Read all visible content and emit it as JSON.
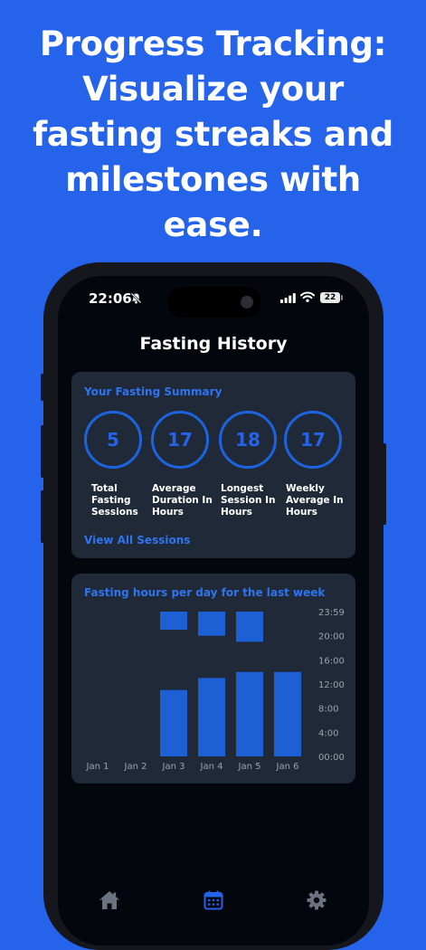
{
  "headline": {
    "lines": [
      "Progress Tracking:",
      "Visualize your",
      "fasting streaks and",
      "milestones with",
      "ease."
    ]
  },
  "status_bar": {
    "time": "22:06",
    "battery": "22"
  },
  "page": {
    "title": "Fasting History"
  },
  "summary": {
    "title": "Your Fasting Summary",
    "stats": [
      {
        "value": "5",
        "label_lines": [
          "Total",
          "Fasting",
          "Sessions"
        ]
      },
      {
        "value": "17",
        "label_lines": [
          "Average",
          "Duration In",
          "Hours"
        ]
      },
      {
        "value": "18",
        "label_lines": [
          "Longest",
          "Session In",
          "Hours"
        ]
      },
      {
        "value": "17",
        "label_lines": [
          "Weekly",
          "Average In",
          "Hours"
        ]
      }
    ],
    "view_all": "View All Sessions"
  },
  "chart_card": {
    "title": "Fasting hours per day for the last week"
  },
  "chart_data": {
    "type": "bar",
    "title": "Fasting hours per day for the last week",
    "categories": [
      "Jan 1",
      "Jan 2",
      "Jan 3",
      "Jan 4",
      "Jan 5",
      "Jan 6"
    ],
    "y_ticks": [
      "23:59",
      "20:00",
      "16:00",
      "12:00",
      "8:00",
      "4:00",
      "00:00"
    ],
    "ylim_hours": [
      0,
      24
    ],
    "y_axis_position": "right",
    "bar_color": "#1d5fd4",
    "segments": [
      {
        "category": "Jan 3",
        "start": 0,
        "end": 11
      },
      {
        "category": "Jan 3",
        "start": 21,
        "end": 24
      },
      {
        "category": "Jan 4",
        "start": 0,
        "end": 13
      },
      {
        "category": "Jan 4",
        "start": 20,
        "end": 24
      },
      {
        "category": "Jan 5",
        "start": 0,
        "end": 14
      },
      {
        "category": "Jan 5",
        "start": 19,
        "end": 24
      },
      {
        "category": "Jan 6",
        "start": 0,
        "end": 14
      }
    ]
  },
  "tab_bar": {
    "items": [
      {
        "icon": "home-icon",
        "active": false
      },
      {
        "icon": "calendar-icon",
        "active": true
      },
      {
        "icon": "gear-icon",
        "active": false
      }
    ]
  },
  "colors": {
    "background": "#2563eb",
    "screen": "#03060d",
    "card": "#1f2937",
    "accent": "#2563eb",
    "inactive_icon": "#6b7280"
  }
}
